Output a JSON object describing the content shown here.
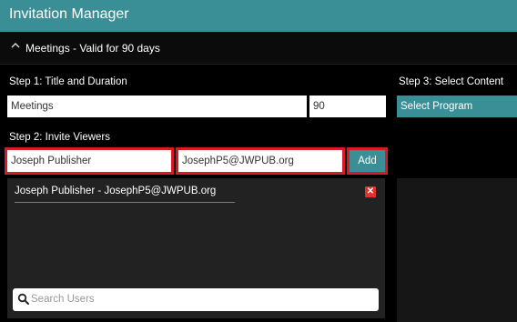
{
  "window": {
    "title": "Invitation Manager"
  },
  "section": {
    "title": "Meetings - Valid for 90 days",
    "chevron_icon": "chevron-up-icon"
  },
  "step1": {
    "label": "Step 1: Title and Duration",
    "title_value": "Meetings",
    "duration_value": "90"
  },
  "step2": {
    "label": "Step 2: Invite Viewers",
    "name_value": "Joseph Publisher",
    "email_value": "JosephP5@JWPUB.org",
    "add_label": "Add"
  },
  "step3": {
    "label": "Step 3: Select Content",
    "select_value": "Select Program"
  },
  "viewers": [
    {
      "text": "Joseph Publisher - JosephP5@JWPUB.org"
    }
  ],
  "search": {
    "placeholder": "Search Users",
    "icon": "search-icon"
  },
  "colors": {
    "accent": "#3a8f96",
    "highlight": "#d61b26",
    "remove": "#e03030"
  }
}
